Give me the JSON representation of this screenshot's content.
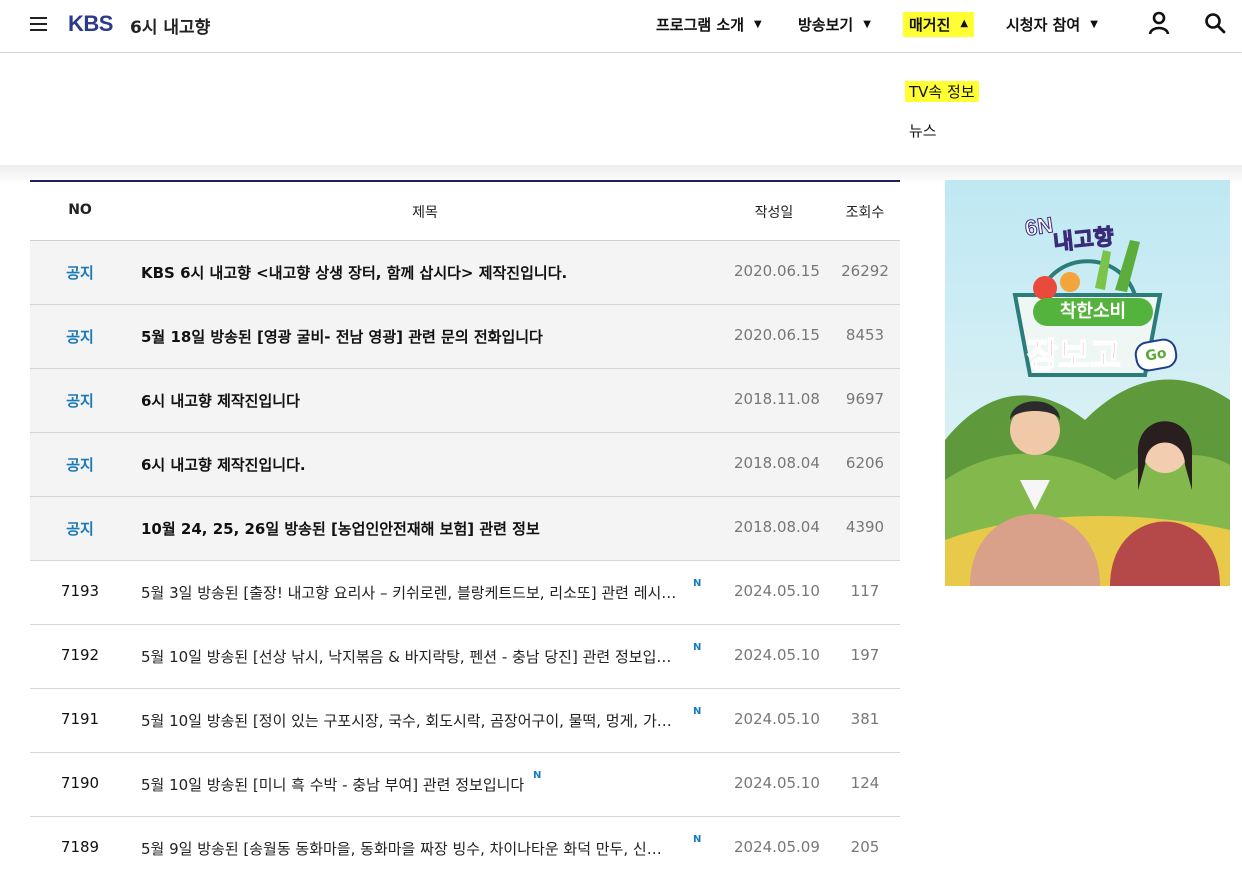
{
  "header": {
    "logo": "KBS",
    "program": "6시 내고향",
    "nav": [
      {
        "label": "프로그램 소개"
      },
      {
        "label": "방송보기"
      },
      {
        "label": "매거진"
      },
      {
        "label": "시청자 참여"
      }
    ]
  },
  "dropdown": {
    "items": [
      "TV속 정보",
      "뉴스"
    ]
  },
  "table": {
    "headers": {
      "no": "NO",
      "title": "제목",
      "date": "작성일",
      "hits": "조회수"
    },
    "new_badge": "N",
    "rows": [
      {
        "no": "공지",
        "title": "KBS 6시 내고향 <내고향 상생 장터, 함께 삽시다> 제작진입니다.",
        "date": "2020.06.15",
        "hits": "26292"
      },
      {
        "no": "공지",
        "title": "5월 18일 방송된 [영광 굴비- 전남 영광] 관련 문의 전화입니다",
        "date": "2020.06.15",
        "hits": "8453"
      },
      {
        "no": "공지",
        "title": "6시 내고향 제작진입니다",
        "date": "2018.11.08",
        "hits": "9697"
      },
      {
        "no": "공지",
        "title": "6시 내고향 제작진입니다.",
        "date": "2018.08.04",
        "hits": "6206"
      },
      {
        "no": "공지",
        "title": "10월 24, 25, 26일 방송된 [농업인안전재해 보험] 관련 정보",
        "date": "2018.08.04",
        "hits": "4390"
      },
      {
        "no": "7193",
        "title": "5월 3일 방송된 [출장! 내고향 요리사 – 키쉬로렌, 블랑케트드보, 리소또] 관련 레시…",
        "date": "2024.05.10",
        "hits": "117"
      },
      {
        "no": "7192",
        "title": "5월 10일 방송된 [선상 낚시, 낙지볶음 & 바지락탕, 펜션 - 충남 당진] 관련 정보입…",
        "date": "2024.05.10",
        "hits": "197"
      },
      {
        "no": "7191",
        "title": "5월 10일 방송된 [정이 있는 구포시장, 국수, 회도시락, 곰장어구이, 물떡, 멍게, 가…",
        "date": "2024.05.10",
        "hits": "381"
      },
      {
        "no": "7190",
        "title": "5월 10일 방송된 [미니 흑 수박 - 충남 부여] 관련 정보입니다",
        "date": "2024.05.10",
        "hits": "124"
      },
      {
        "no": "7189",
        "title": "5월 9일 방송된 [송월동 동화마을, 동화마을 짜장 빙수, 차이나타운 화덕 만두, 신…",
        "date": "2024.05.09",
        "hits": "205"
      }
    ]
  },
  "banner": {
    "badge": "6N",
    "program": "내고향",
    "line1": "착한소비",
    "line2": "장보고",
    "tag": "Go"
  },
  "colors": {
    "accent": "#1a7bb8",
    "highlight": "#ffff33",
    "logo": "#2b3a8a"
  }
}
